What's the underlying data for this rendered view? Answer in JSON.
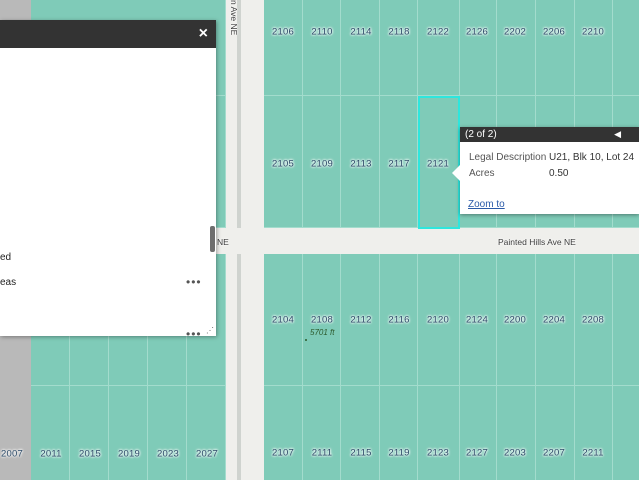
{
  "map": {
    "lots_top_row": [
      "2106",
      "2110",
      "2114",
      "2118",
      "2122",
      "2126",
      "2202",
      "2206",
      "2210"
    ],
    "lots_row2": [
      "2105",
      "2109",
      "2113",
      "2117",
      "2121"
    ],
    "lots_row3": [
      "2104",
      "2108",
      "2112",
      "2116",
      "2120",
      "2124",
      "2200",
      "2204",
      "2208"
    ],
    "lots_row4": [
      "2107",
      "2111",
      "2115",
      "2119",
      "2123",
      "2127",
      "2203",
      "2207",
      "2211"
    ],
    "lots_bottom_left": [
      "2007",
      "2011",
      "2015",
      "2019",
      "2023",
      "2027"
    ],
    "street_horizontal": "Painted Hills Ave NE",
    "street_horizontal_cut": "NE",
    "street_vertical_cut": "n Ave NE",
    "elevation_label": "5701 ft",
    "colors": {
      "parcel": "#7fcbb8",
      "road": "#efefec",
      "highlight": "#2ee6dd"
    }
  },
  "panel": {
    "close_icon": "×",
    "text_line1": "ed",
    "text_line2": "eas",
    "more_label": "•••"
  },
  "popup": {
    "header": "(2 of 2)",
    "nav_icon": "◀",
    "rows": [
      {
        "label": "Legal Description",
        "value": "U21, Blk 10, Lot 24"
      },
      {
        "label": "Acres",
        "value": "0.50"
      }
    ],
    "zoom_link": "Zoom to"
  }
}
